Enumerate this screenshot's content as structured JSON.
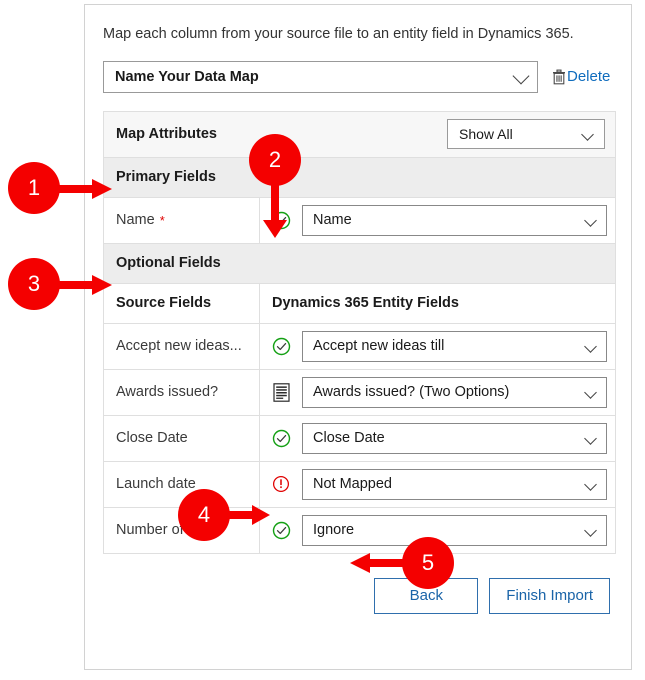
{
  "dialog": {
    "intro": "Map each column from your source file to an entity field in Dynamics 365.",
    "map_name_value": "Name Your Data Map",
    "delete_label": "Delete",
    "delete_icon": "trash-icon",
    "dropdown_icon": "chevron-down-icon"
  },
  "attributes": {
    "header_label": "Map Attributes",
    "filter_value": "Show All",
    "primary_section": "Primary Fields",
    "optional_section": "Optional Fields",
    "col_source": "Source Fields",
    "col_target": "Dynamics 365 Entity Fields"
  },
  "primary_rows": [
    {
      "source": "Name",
      "required": "*",
      "status": "ok",
      "status_icon": "check-circle-icon",
      "target": "Name"
    }
  ],
  "optional_rows": [
    {
      "source": "Accept new ideas...",
      "status": "ok",
      "status_icon": "check-circle-icon",
      "target": "Accept new ideas till"
    },
    {
      "source": "Awards issued?",
      "status": "list",
      "status_icon": "list-icon",
      "target": "Awards issued? (Two Options)"
    },
    {
      "source": "Close Date",
      "status": "ok",
      "status_icon": "check-circle-icon",
      "target": "Close Date"
    },
    {
      "source": "Launch date",
      "status": "warn",
      "status_icon": "warning-circle-icon",
      "target": "Not Mapped"
    },
    {
      "source": "Number of ideas",
      "status": "ok",
      "status_icon": "check-circle-icon",
      "target": "Ignore"
    }
  ],
  "footer": {
    "back_label": "Back",
    "finish_label": "Finish Import"
  },
  "callouts": [
    {
      "number": "1",
      "points_to": "primary-fields-section"
    },
    {
      "number": "2",
      "points_to": "name-row-status-icon"
    },
    {
      "number": "3",
      "points_to": "optional-fields-section"
    },
    {
      "number": "4",
      "points_to": "launch-date-status-icon"
    },
    {
      "number": "5",
      "points_to": "number-of-ideas-target-value"
    }
  ],
  "colors": {
    "callout_red": "#f40000",
    "link_blue": "#0f6cbd",
    "button_blue": "#1a64a8",
    "status_ok_green": "#14a014",
    "status_warn_red": "#e00000",
    "required_red": "#e00000",
    "band_gray": "#ededed",
    "header_gray": "#f7f7f7"
  }
}
